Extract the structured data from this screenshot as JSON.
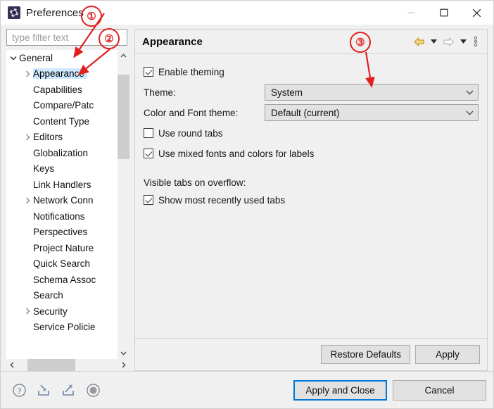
{
  "window": {
    "title": "Preferences",
    "icon": "preferences-gear-icon",
    "controls": {
      "minimize": "minimize-icon",
      "maximize": "maximize-icon",
      "close": "close-icon"
    }
  },
  "filter": {
    "placeholder": "type filter text",
    "value": ""
  },
  "tree": {
    "items": [
      {
        "label": "General",
        "depth": 0,
        "expanded": true,
        "hasChildren": true,
        "selected": false
      },
      {
        "label": "Appearance",
        "depth": 1,
        "expanded": false,
        "hasChildren": true,
        "selected": true
      },
      {
        "label": "Capabilities",
        "depth": 1,
        "expanded": false,
        "hasChildren": false,
        "selected": false
      },
      {
        "label": "Compare/Patc",
        "depth": 1,
        "expanded": false,
        "hasChildren": false,
        "selected": false
      },
      {
        "label": "Content Type",
        "depth": 1,
        "expanded": false,
        "hasChildren": false,
        "selected": false
      },
      {
        "label": "Editors",
        "depth": 1,
        "expanded": false,
        "hasChildren": true,
        "selected": false
      },
      {
        "label": "Globalization",
        "depth": 1,
        "expanded": false,
        "hasChildren": false,
        "selected": false
      },
      {
        "label": "Keys",
        "depth": 1,
        "expanded": false,
        "hasChildren": false,
        "selected": false
      },
      {
        "label": "Link Handlers",
        "depth": 1,
        "expanded": false,
        "hasChildren": false,
        "selected": false
      },
      {
        "label": "Network Conn",
        "depth": 1,
        "expanded": false,
        "hasChildren": true,
        "selected": false
      },
      {
        "label": "Notifications",
        "depth": 1,
        "expanded": false,
        "hasChildren": false,
        "selected": false
      },
      {
        "label": "Perspectives",
        "depth": 1,
        "expanded": false,
        "hasChildren": false,
        "selected": false
      },
      {
        "label": "Project Nature",
        "depth": 1,
        "expanded": false,
        "hasChildren": false,
        "selected": false
      },
      {
        "label": "Quick Search",
        "depth": 1,
        "expanded": false,
        "hasChildren": false,
        "selected": false
      },
      {
        "label": "Schema Assoc",
        "depth": 1,
        "expanded": false,
        "hasChildren": false,
        "selected": false
      },
      {
        "label": "Search",
        "depth": 1,
        "expanded": false,
        "hasChildren": false,
        "selected": false
      },
      {
        "label": "Security",
        "depth": 1,
        "expanded": false,
        "hasChildren": true,
        "selected": false
      },
      {
        "label": "Service Policie",
        "depth": 1,
        "expanded": false,
        "hasChildren": false,
        "selected": false
      }
    ]
  },
  "panel": {
    "title": "Appearance",
    "toolbar": {
      "back": "back-arrow-icon",
      "back_menu": "back-dropdown-icon",
      "forward": "forward-arrow-icon",
      "forward_menu": "forward-dropdown-icon",
      "menu": "view-menu-icon"
    },
    "enable_theming": {
      "label": "Enable theming",
      "checked": true
    },
    "theme": {
      "label": "Theme:",
      "value": "System"
    },
    "color_font_theme": {
      "label": "Color and Font theme:",
      "value": "Default (current)"
    },
    "round_tabs": {
      "label": "Use round tabs",
      "checked": false
    },
    "mixed_fonts": {
      "label": "Use mixed fonts and colors for labels",
      "checked": true
    },
    "overflow_section_label": "Visible tabs on overflow:",
    "show_mru_tabs": {
      "label": "Show most recently used tabs",
      "checked": true
    },
    "restore_defaults_label": "Restore Defaults",
    "apply_label": "Apply"
  },
  "bottom": {
    "icons": [
      "help-icon",
      "import-preferences-icon",
      "export-preferences-icon",
      "record-icon"
    ],
    "apply_and_close_label": "Apply and Close",
    "cancel_label": "Cancel"
  },
  "annotations": {
    "accent_color": "#e02020",
    "markers": [
      {
        "text": "①",
        "target": "general-tree-item"
      },
      {
        "text": "②",
        "target": "appearance-tree-item"
      },
      {
        "text": "③",
        "target": "theme-combo"
      }
    ]
  }
}
